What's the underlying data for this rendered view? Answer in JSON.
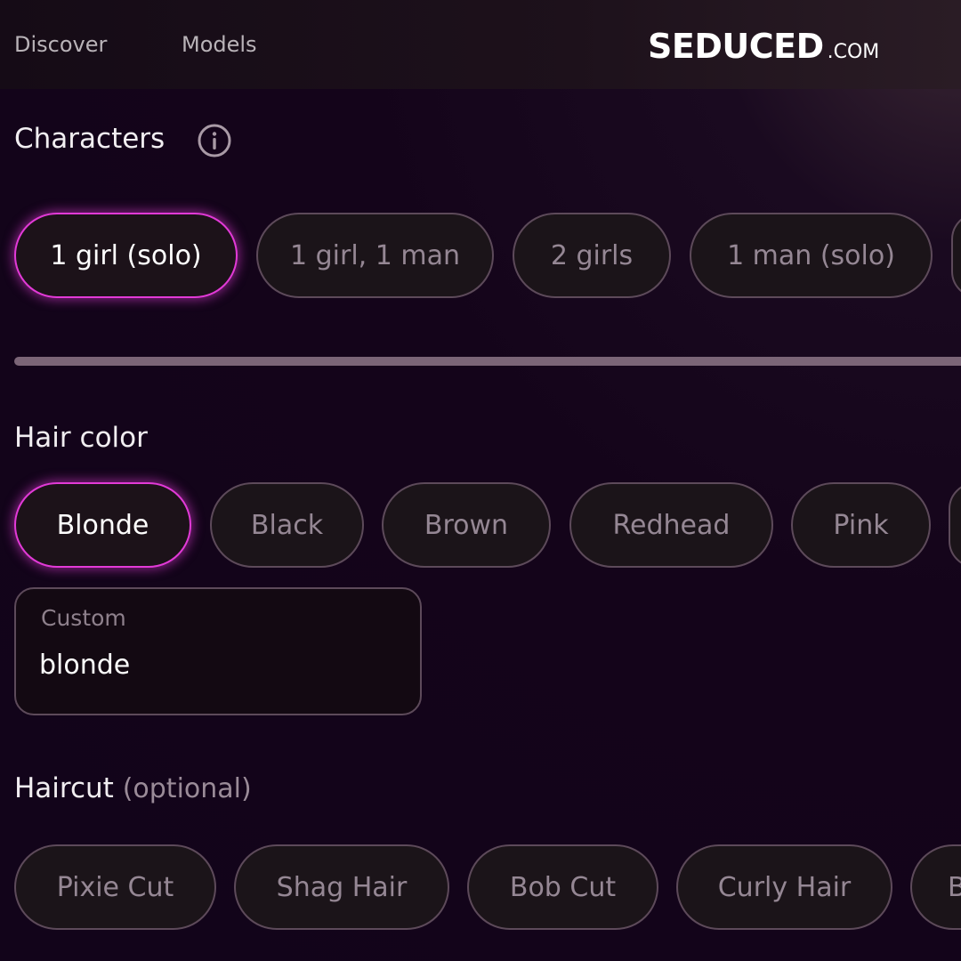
{
  "nav": {
    "discover": "Discover",
    "models": "Models"
  },
  "logo": {
    "main": "SEDUCED",
    "domain": ".COM"
  },
  "characters": {
    "title": "Characters",
    "options": [
      "1 girl (solo)",
      "1 girl, 1 man",
      "2 girls",
      "1 man (solo)"
    ],
    "selected": "1 girl (solo)"
  },
  "hair_color": {
    "title": "Hair color",
    "options": [
      "Blonde",
      "Black",
      "Brown",
      "Redhead",
      "Pink"
    ],
    "selected": "Blonde",
    "custom": {
      "label": "Custom",
      "value": "blonde"
    }
  },
  "haircut": {
    "title": "Haircut",
    "optional_label": "(optional)",
    "options": [
      "Pixie Cut",
      "Shag Hair",
      "Bob Cut",
      "Curly Hair",
      "B"
    ]
  },
  "colors": {
    "accent": "#e23ad7",
    "background": "#12041a",
    "chip_border": "#5d4a5a",
    "chip_text": "#958794"
  },
  "icons": {
    "info": "info-icon"
  }
}
